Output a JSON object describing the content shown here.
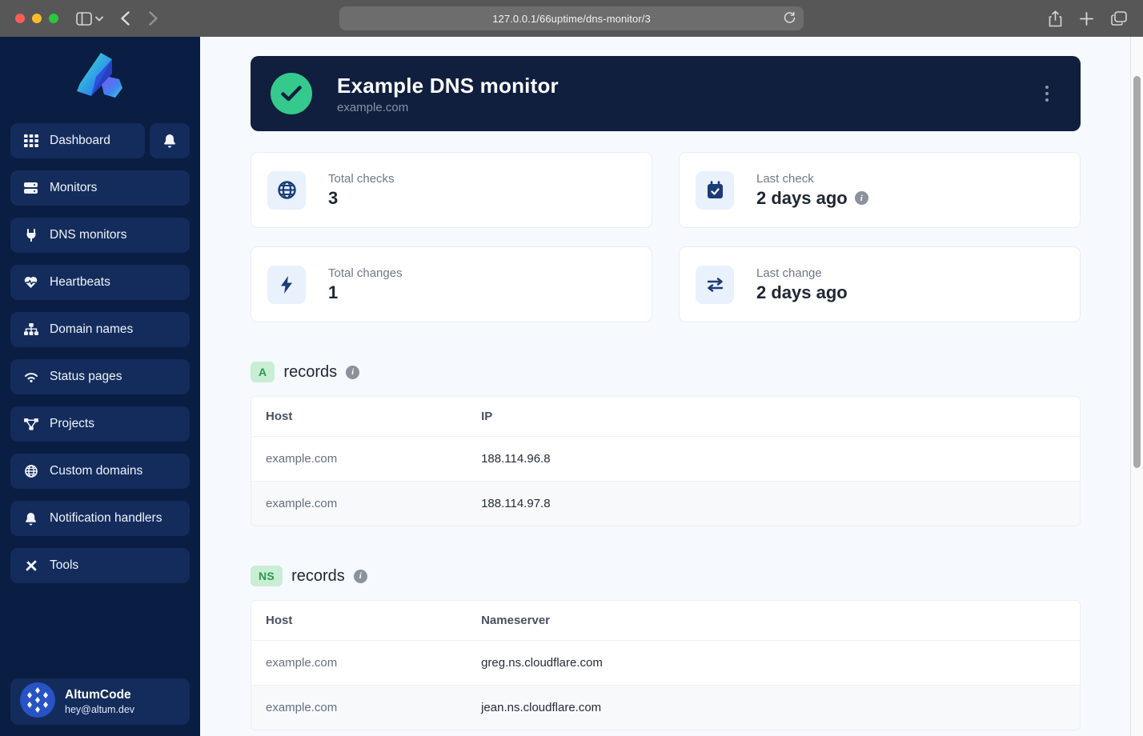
{
  "browser": {
    "url": "127.0.0.1/66uptime/dns-monitor/3"
  },
  "sidebar": {
    "dashboard_label": "Dashboard",
    "items": [
      {
        "label": "Monitors",
        "icon": "server-icon"
      },
      {
        "label": "DNS monitors",
        "icon": "plug-icon"
      },
      {
        "label": "Heartbeats",
        "icon": "heart-pulse-icon"
      },
      {
        "label": "Domain names",
        "icon": "sitemap-icon"
      },
      {
        "label": "Status pages",
        "icon": "signal-icon"
      },
      {
        "label": "Projects",
        "icon": "project-diagram-icon"
      },
      {
        "label": "Custom domains",
        "icon": "globe-icon"
      },
      {
        "label": "Notification handlers",
        "icon": "bell-icon"
      },
      {
        "label": "Tools",
        "icon": "tools-icon"
      }
    ],
    "user": {
      "name": "AltumCode",
      "email": "hey@altum.dev"
    }
  },
  "hero": {
    "title": "Example DNS monitor",
    "subtitle": "example.com",
    "status": "up"
  },
  "stats": [
    {
      "label": "Total checks",
      "value": "3",
      "icon": "globe-icon",
      "has_info": false
    },
    {
      "label": "Last check",
      "value": "2 days ago",
      "icon": "calendar-check-icon",
      "has_info": true
    },
    {
      "label": "Total changes",
      "value": "1",
      "icon": "bolt-icon",
      "has_info": false
    },
    {
      "label": "Last change",
      "value": "2 days ago",
      "icon": "exchange-icon",
      "has_info": false
    }
  ],
  "sections": [
    {
      "badge": "A",
      "title": "records",
      "columns": {
        "c0": "Host",
        "c1": "IP"
      },
      "rows": [
        [
          "example.com",
          "188.114.96.8"
        ],
        [
          "example.com",
          "188.114.97.8"
        ]
      ]
    },
    {
      "badge": "NS",
      "title": "records",
      "columns": {
        "c0": "Host",
        "c1": "Nameserver"
      },
      "rows": [
        [
          "example.com",
          "greg.ns.cloudflare.com"
        ],
        [
          "example.com",
          "jean.ns.cloudflare.com"
        ]
      ]
    }
  ],
  "colors": {
    "accent_green": "#35c98e",
    "sidebar_bg": "#0a1d43",
    "sidebar_button_bg": "#142c5c",
    "hero_bg": "#101f3e",
    "badge_green_bg": "#c9eed3",
    "badge_green_text": "#27994f",
    "stat_tile_bg": "#e8f1fc",
    "stat_icon_navy": "#1b3c77"
  }
}
